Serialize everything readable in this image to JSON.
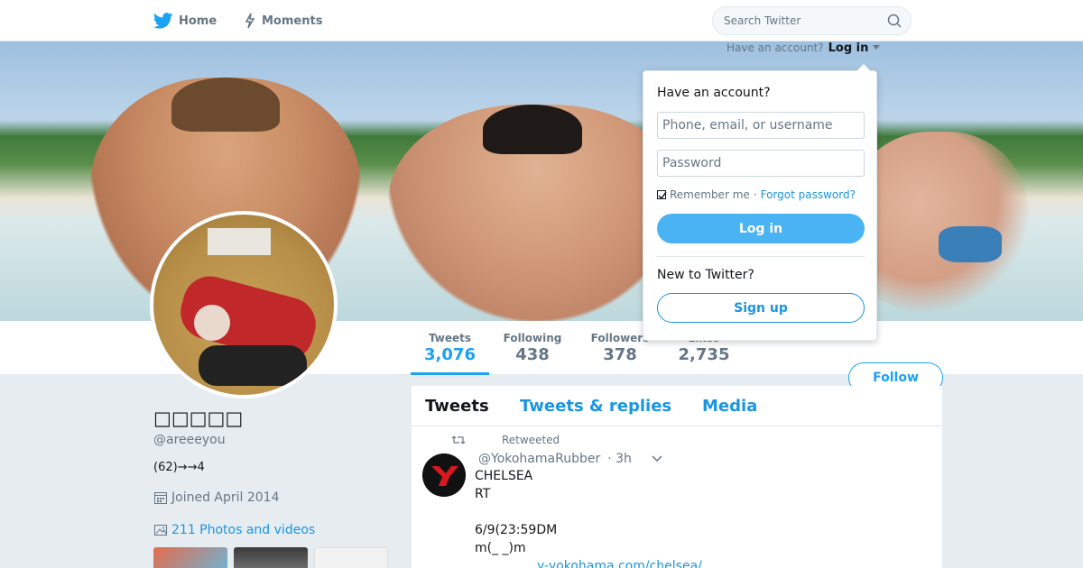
{
  "nav": {
    "home_label": "Home",
    "moments_label": "Moments",
    "search_placeholder": "Search Twitter"
  },
  "account_hint": {
    "text": "Have an account?",
    "login_label": "Log in"
  },
  "login_dropdown": {
    "title": "Have an account?",
    "username_placeholder": "Phone, email, or username",
    "password_placeholder": "Password",
    "remember_label": "Remember me",
    "separator": "·",
    "forgot_label": "Forgot password?",
    "login_button": "Log in",
    "new_label": "New to Twitter?",
    "signup_button": "Sign up"
  },
  "stats": [
    {
      "label": "Tweets",
      "value": "3,076"
    },
    {
      "label": "Following",
      "value": "438"
    },
    {
      "label": "Followers",
      "value": "378"
    },
    {
      "label": "Likes",
      "value": "2,735"
    }
  ],
  "follow_button": "Follow",
  "profile": {
    "name": "□□□□□",
    "handle": "@areeeyou",
    "bio": "(62)→→4",
    "joined": "Joined April 2014",
    "photos_link": "211 Photos and videos"
  },
  "timeline": {
    "tabs": [
      "Tweets",
      "Tweets & replies",
      "Media"
    ],
    "tweet": {
      "retweet_label": "Retweeted",
      "handle": "@YokohamaRubber",
      "time": "· 3h",
      "lines": [
        "CHELSEA",
        "RT",
        "",
        "6/9(23:59DM",
        "m(_ _)m"
      ],
      "link": "y-yokohama.com/chelsea/"
    }
  },
  "colors": {
    "accent": "#1da1f2",
    "link": "#1b95e0",
    "login_button_bg": "#4ab3f4"
  }
}
